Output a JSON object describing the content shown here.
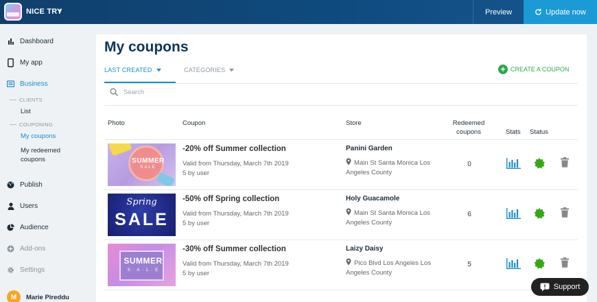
{
  "topbar": {
    "app_name": "NICE TRY",
    "chevron": "▾",
    "preview_label": "Preview",
    "update_label": "Update now"
  },
  "sidebar": {
    "dashboard": "Dashboard",
    "my_app": "My app",
    "business": "Business",
    "clients_header": "CLIENTS",
    "clients_list": "List",
    "couponing_header": "COUPONING",
    "my_coupons": "My coupons",
    "my_redeemed_line1": "My redeemed",
    "my_redeemed_line2": "coupons",
    "publish": "Publish",
    "users": "Users",
    "audience": "Audience",
    "addons": "Add-ons",
    "settings": "Settings",
    "user_initial": "M",
    "user_name": "Marie Pireddu"
  },
  "main": {
    "title": "My coupons",
    "tab_last_created": "LAST CREATED",
    "tab_categories": "CATEGORIES",
    "create_label": "CREATE A COUPON",
    "search_placeholder": "Search",
    "columns": {
      "photo": "Photo",
      "coupon": "Coupon",
      "store": "Store",
      "redeemed_line1": "Redeemed",
      "redeemed_line2": "coupons",
      "stats": "Stats",
      "status": "Status"
    },
    "rows": [
      {
        "title": "-20% off Summer collection",
        "valid": "Valid from Thursday, March 7th 2019",
        "by_user": "5 by user",
        "store": "Panini Garden",
        "address": "Main St Santa Monica Los Angeles County",
        "redeemed": "0",
        "thumb_text": "SUMMER",
        "thumb_sub": "SALE"
      },
      {
        "title": "-50% off Spring collection",
        "valid": "Valid from Thursday, March 7th 2019",
        "by_user": "5 by user",
        "store": "Holy Guacamole",
        "address": "Main St Santa Monica Los Angeles County",
        "redeemed": "6",
        "thumb_text": "Spring",
        "thumb_sub": "SALE"
      },
      {
        "title": "-30% off Summer collection",
        "valid": "Valid from Thursday, March 7th 2019",
        "by_user": "5 by user",
        "store": "Laizy Daisy",
        "address": "Pico Blvd Los Angeles Los Angeles County",
        "redeemed": "5",
        "thumb_text": "SUMMER",
        "thumb_sub": "S · A · L · E"
      }
    ]
  },
  "support_label": "Support",
  "colors": {
    "accent": "#1a8cc8",
    "green": "#2fa84f",
    "topbar": "#103f6b",
    "title": "#0d3557"
  }
}
